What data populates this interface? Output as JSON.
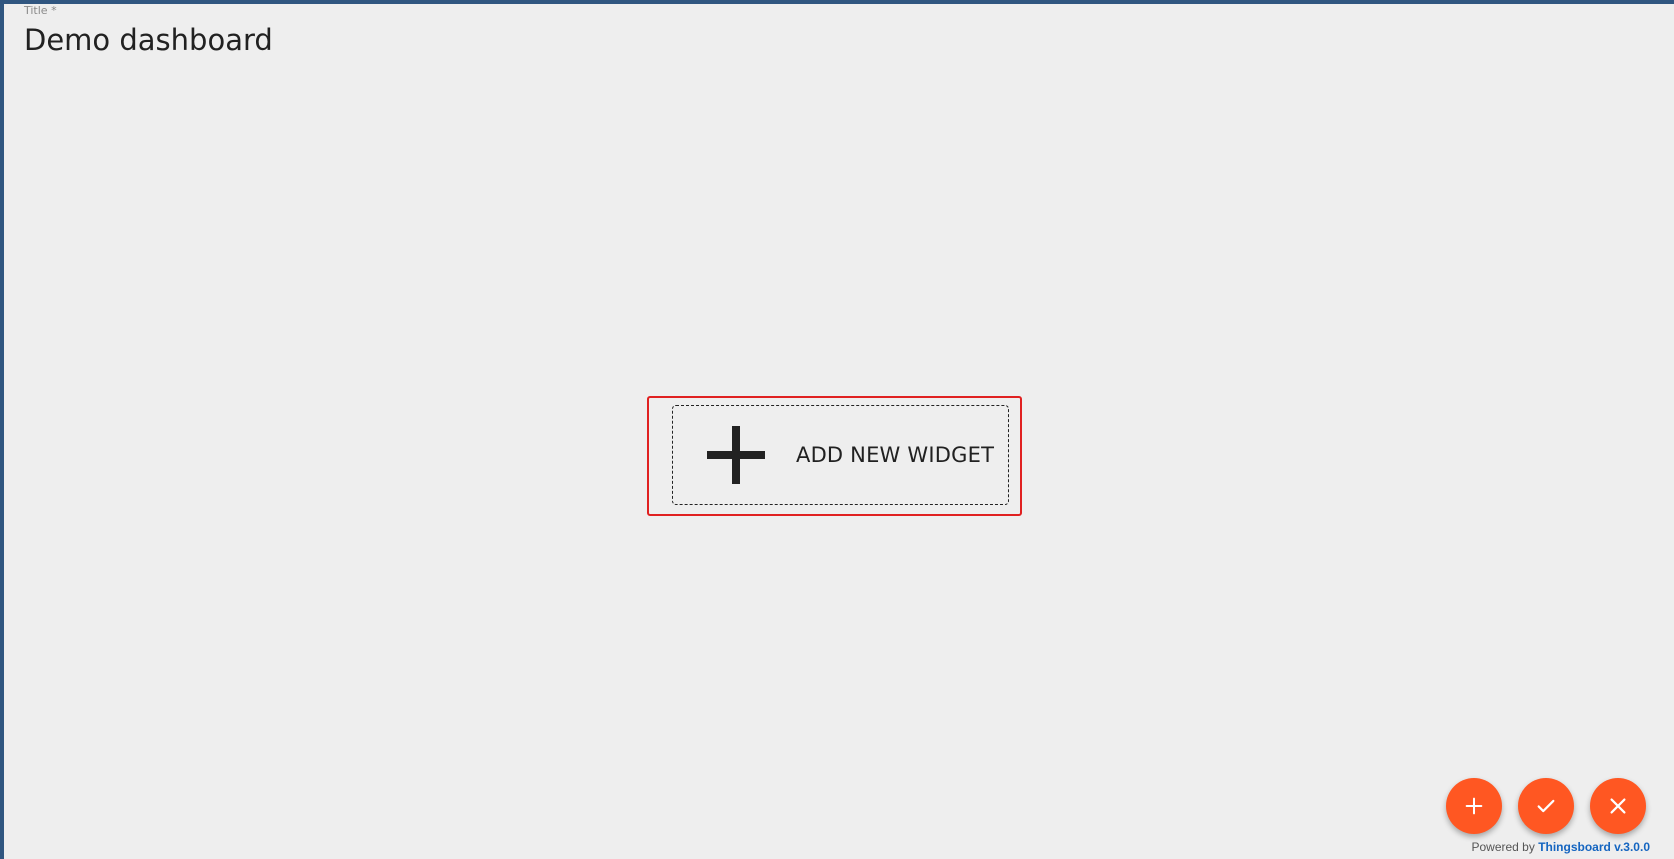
{
  "dashboard": {
    "title_label": "Title *",
    "title_value": "Demo dashboard"
  },
  "add_widget": {
    "label": "ADD NEW WIDGET",
    "icon": "plus-icon",
    "highlight_color": "#e02020"
  },
  "fab": {
    "accent_color": "#ff5722",
    "buttons": [
      {
        "name": "add-widget-fab",
        "icon": "plus-icon"
      },
      {
        "name": "apply-fab",
        "icon": "check-icon"
      },
      {
        "name": "cancel-fab",
        "icon": "close-icon"
      }
    ]
  },
  "footer": {
    "powered_by": "Powered by",
    "link_text": "Thingsboard v.3.0.0",
    "link_color": "#1565c0"
  }
}
